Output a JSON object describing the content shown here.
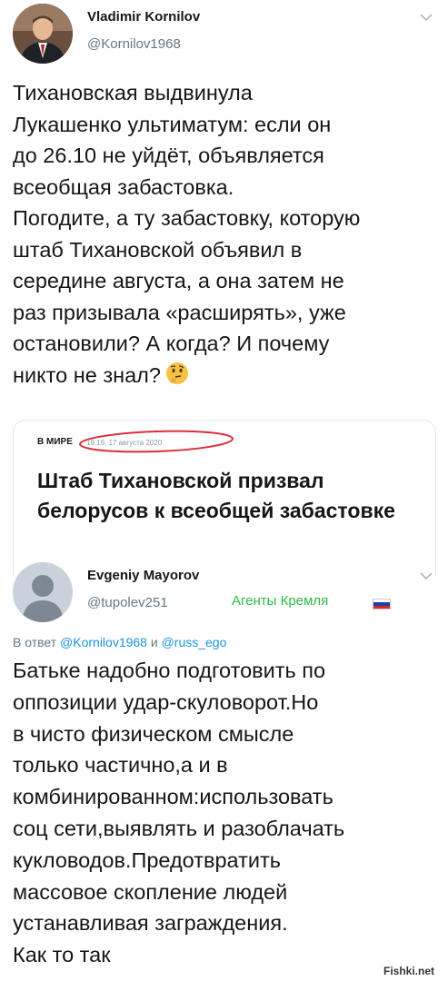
{
  "tweet1": {
    "author_name": "Vladimir Kornilov",
    "author_handle": "@Kornilov1968",
    "text": "Тихановская выдвинула\nЛукашенко ультиматум: если он\nдо 26.10 не уйдёт, объявляется\nвсеобщая забастовка.\nПогодите, а ту забастовку, которую\nштаб Тихановской объявил в\nсередине августа, а она затем не\nраз призывала «расширять», уже\nостановили? А когда? И почему\nникто не знал?",
    "emoji": "thinking-face-icon",
    "card": {
      "category": "В МИРЕ",
      "date": "19:19, 17 августа 2020",
      "title": "Штаб Тихановской призвал белорусов к всеобщей забастовке"
    }
  },
  "tweet2": {
    "author_name": "Evgeniy Mayorov",
    "author_handle": "@tupolev251",
    "badge": "Агенты Кремля",
    "flag_icon": "russia-flag-icon",
    "reply_prefix": "В ответ",
    "reply_handle_1": "@Kornilov1968",
    "reply_joiner": "и",
    "reply_handle_2": "@russ_ego",
    "text": "Батьке надобно подготовить по\nоппозиции удар-скуловорот.Но\nв чисто физическом смысле\nтолько частично,а и в\nкомбинированном:использовать\nсоц сети,выявлять и разоблачать\nкукловодов.Предотвратить\nмассовое скопление людей\nустанавливая заграждения.\nКак то так"
  },
  "watermark": "Fishki.net",
  "colors": {
    "link": "#1b95e0",
    "secondary": "#657786",
    "badge": "#2fb94b",
    "highlight": "#d9303a"
  }
}
